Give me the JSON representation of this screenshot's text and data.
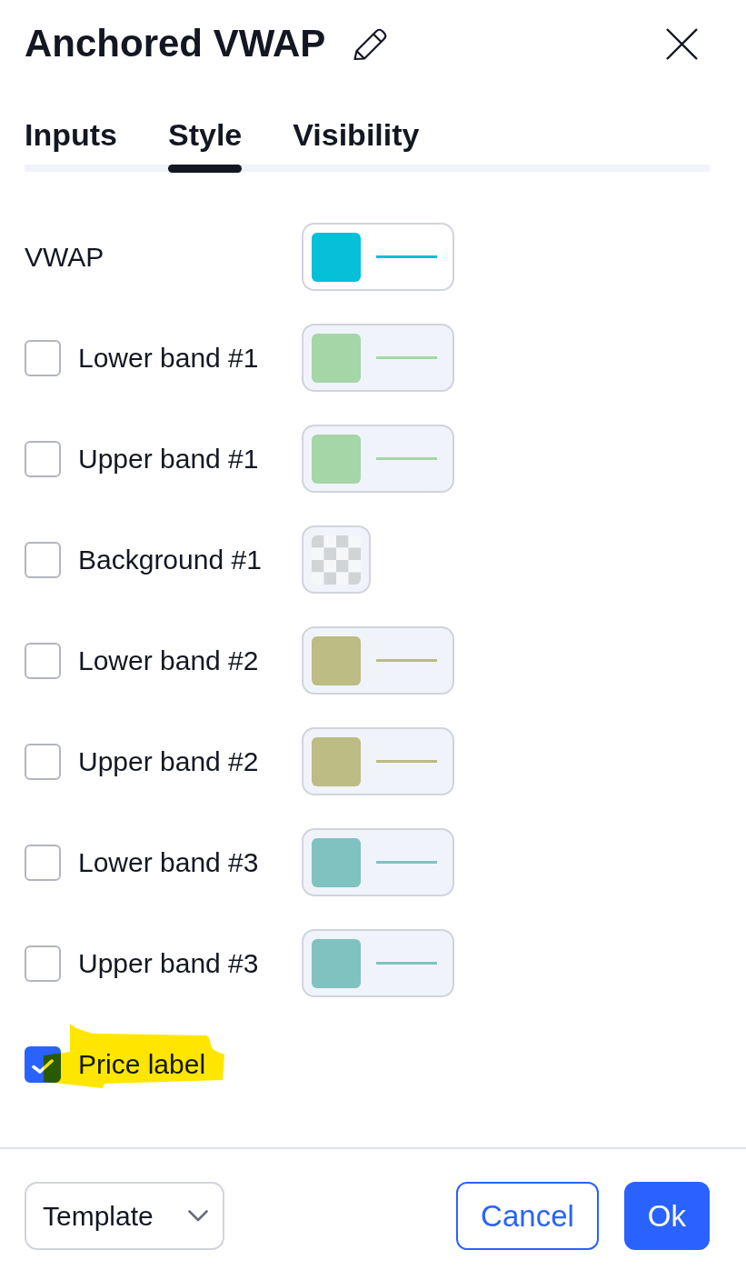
{
  "title": "Anchored VWAP",
  "tabs": [
    {
      "label": "Inputs",
      "selected": false
    },
    {
      "label": "Style",
      "selected": true
    },
    {
      "label": "Visibility",
      "selected": false
    }
  ],
  "vwap": {
    "kind": "line",
    "label": "VWAP",
    "color": "#06bfd8",
    "disabled": false
  },
  "bands": [
    {
      "kind": "line",
      "label": "Lower band #1",
      "checked": false,
      "color": "#a5d6a7",
      "disabled": true
    },
    {
      "kind": "line",
      "label": "Upper band #1",
      "checked": false,
      "color": "#a5d6a7",
      "disabled": true
    },
    {
      "kind": "fill",
      "label": "Background #1",
      "checked": false,
      "disabled": true
    },
    {
      "kind": "line",
      "label": "Lower band #2",
      "checked": false,
      "color": "#bcbc84",
      "disabled": true
    },
    {
      "kind": "line",
      "label": "Upper band #2",
      "checked": false,
      "color": "#bcbc84",
      "disabled": true
    },
    {
      "kind": "line",
      "label": "Lower band #3",
      "checked": false,
      "color": "#80c2bf",
      "disabled": true
    },
    {
      "kind": "line",
      "label": "Upper band #3",
      "checked": false,
      "color": "#80c2bf",
      "disabled": true
    }
  ],
  "price_label": {
    "label": "Price label",
    "checked": true,
    "highlighted": true
  },
  "footer": {
    "template": "Template",
    "buttons": [
      {
        "label": "Cancel",
        "kind": "secondary"
      },
      {
        "label": "Ok",
        "kind": "primary"
      }
    ]
  }
}
